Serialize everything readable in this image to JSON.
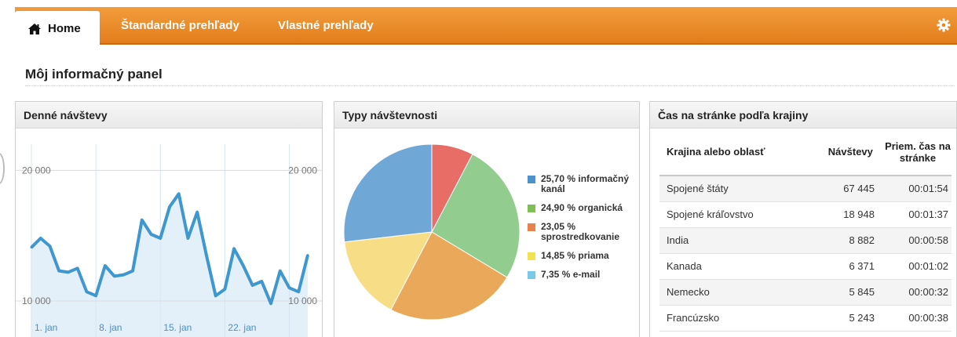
{
  "nav": {
    "home_label": "Home",
    "links": [
      "Štandardné prehľady",
      "Vlastné prehľady"
    ]
  },
  "page_title": "Môj informačný panel",
  "daily_visits": {
    "title": "Denné návštevy"
  },
  "traffic_types": {
    "title": "Typy návštevnosti"
  },
  "time_on_site": {
    "title": "Čas na stránke podľa krajiny",
    "columns": [
      "Krajina alebo oblasť",
      "Návštevy",
      "Priem. čas na stránke"
    ],
    "rows": [
      [
        "Spojené štáty",
        "67 445",
        "00:01:54"
      ],
      [
        "Spojené kráľovstvo",
        "18 948",
        "00:01:37"
      ],
      [
        "India",
        "8 882",
        "00:00:58"
      ],
      [
        "Kanada",
        "6 371",
        "00:01:02"
      ],
      [
        "Nemecko",
        "5 845",
        "00:00:32"
      ],
      [
        "Francúzsko",
        "5 243",
        "00:00:38"
      ]
    ]
  },
  "chart_data": [
    {
      "type": "area",
      "title": "Denné návštevy",
      "x": [
        "1. jan",
        "2. jan",
        "3. jan",
        "4. jan",
        "5. jan",
        "6. jan",
        "7. jan",
        "8. jan",
        "9. jan",
        "10. jan",
        "11. jan",
        "12. jan",
        "13. jan",
        "14. jan",
        "15. jan",
        "16. jan",
        "17. jan",
        "18. jan",
        "19. jan",
        "20. jan",
        "21. jan",
        "22. jan",
        "23. jan",
        "24. jan",
        "25. jan",
        "26. jan",
        "27. jan",
        "28. jan",
        "29. jan",
        "30. jan"
      ],
      "xtick_labels": [
        "1. jan",
        "8. jan",
        "15. jan",
        "22. jan"
      ],
      "y": [
        14100,
        14800,
        14200,
        12300,
        12200,
        12500,
        10700,
        10400,
        12700,
        11900,
        12000,
        12300,
        16200,
        15100,
        14800,
        17200,
        18200,
        14800,
        16800,
        13500,
        10400,
        10900,
        14000,
        12700,
        11200,
        11500,
        9800,
        12300,
        11000,
        10700,
        13500
      ],
      "yticks": [
        10000,
        20000
      ],
      "ytick_labels": [
        "10 000",
        "20 000"
      ],
      "ylim": [
        7000,
        22000
      ],
      "color": "#3f97cf"
    },
    {
      "type": "pie",
      "title": "Typy návštevnosti",
      "labels": [
        "informačný kanál",
        "organická",
        "sprostredkovanie",
        "priama",
        "e-mail"
      ],
      "legend_texts": [
        "25,70 % informačný kanál",
        "24,90 % organická",
        "23,05 % sprostredkovanie",
        "14,85 % priama",
        "7,35 % e-mail"
      ],
      "values": [
        25.7,
        24.9,
        23.05,
        14.85,
        7.35
      ],
      "legend_colors": [
        "#4d92cc",
        "#7fbf55",
        "#e8824a",
        "#f3e24f",
        "#79c9ea"
      ],
      "slice_colors": [
        "#e96d67",
        "#92cc8f",
        "#eaa95a",
        "#f7dd86",
        "#6fa8d6"
      ]
    }
  ]
}
